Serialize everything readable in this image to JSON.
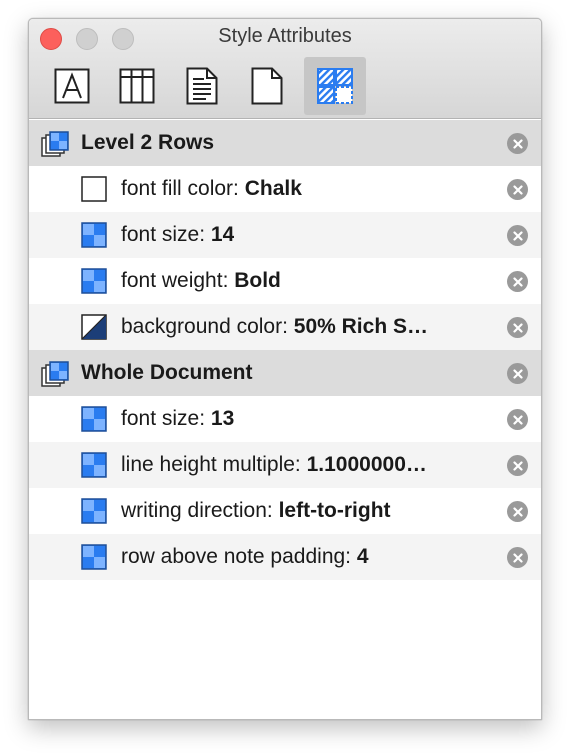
{
  "window": {
    "title": "Style Attributes"
  },
  "toolbar": {
    "tools": [
      {
        "name": "text-style-icon"
      },
      {
        "name": "columns-icon"
      },
      {
        "name": "document-text-icon"
      },
      {
        "name": "page-icon"
      },
      {
        "name": "style-attributes-icon",
        "selected": true
      }
    ]
  },
  "groups": [
    {
      "label": "Level 2 Rows",
      "items": [
        {
          "key": "font fill color: ",
          "value": "Chalk",
          "swatch": "white"
        },
        {
          "key": "font size: ",
          "value": "14",
          "swatch": "blue"
        },
        {
          "key": "font weight: ",
          "value": "Bold",
          "swatch": "blue"
        },
        {
          "key": "background color: ",
          "value": "50% Rich S…",
          "swatch": "split"
        }
      ]
    },
    {
      "label": "Whole Document",
      "items": [
        {
          "key": "font size: ",
          "value": "13",
          "swatch": "blue"
        },
        {
          "key": "line height multiple: ",
          "value": "1.1000000…",
          "swatch": "blue"
        },
        {
          "key": "writing direction: ",
          "value": "left-to-right",
          "swatch": "blue"
        },
        {
          "key": "row above note padding: ",
          "value": "4",
          "swatch": "blue"
        }
      ]
    }
  ],
  "colors": {
    "accent_blue": "#2a7cf0",
    "group_background": "#dcdcdc",
    "alt_row_background": "#f4f4f4",
    "remove_button": "#9a9a9a"
  }
}
